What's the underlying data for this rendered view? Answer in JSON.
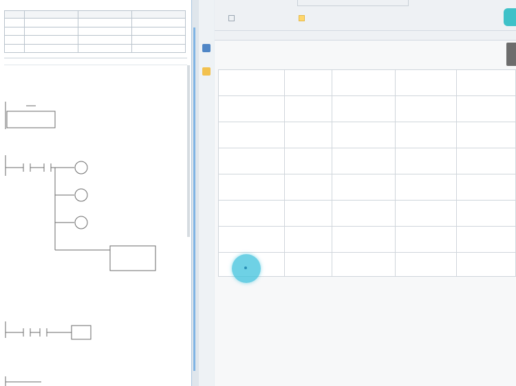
{
  "ladder": {
    "var_table": {
      "header": [
        "",
        "",
        "",
        ""
      ],
      "rows": [
        [
          "",
          "",
          "",
          ""
        ],
        [
          "",
          "",
          "",
          ""
        ],
        [
          "",
          "",
          "",
          ""
        ],
        [
          "",
          "",
          "",
          ""
        ]
      ]
    },
    "networks": [
      {
        "label": ""
      },
      {
        "label": ""
      },
      {
        "label": ""
      },
      {
        "label": ""
      }
    ]
  },
  "toolbar": {
    "tabs": [
      {
        "label": "",
        "icon": "table-icon"
      },
      {
        "label": "",
        "icon": "folder-icon"
      }
    ],
    "status_text": ""
  },
  "view": {
    "section_title": "",
    "grid": {
      "header": [
        "",
        "",
        "",
        "",
        ""
      ],
      "rows": [
        [
          "",
          "",
          "",
          "",
          ""
        ],
        [
          "",
          "",
          "",
          "",
          ""
        ],
        [
          "",
          "",
          "",
          "",
          ""
        ],
        [
          "",
          "",
          "",
          "",
          ""
        ],
        [
          "",
          "",
          "",
          "",
          ""
        ],
        [
          "",
          "",
          "",
          "",
          ""
        ],
        [
          "",
          "",
          "",
          "",
          ""
        ]
      ]
    }
  },
  "colors": {
    "accent": "#3ec1c8",
    "splitter": "#7fb4e4",
    "grid_border": "#cfd5db"
  }
}
